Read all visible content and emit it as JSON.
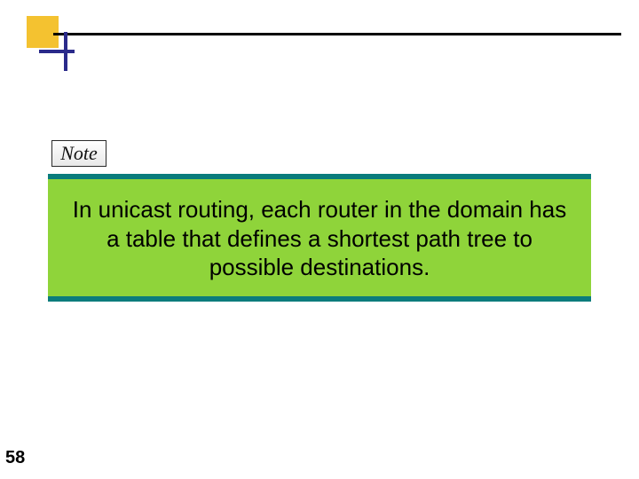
{
  "header": {
    "note_label": "Note"
  },
  "content": {
    "body_text": "In unicast routing, each router in the domain has a table that defines a shortest path tree to possible destinations."
  },
  "page": {
    "number": "58"
  }
}
